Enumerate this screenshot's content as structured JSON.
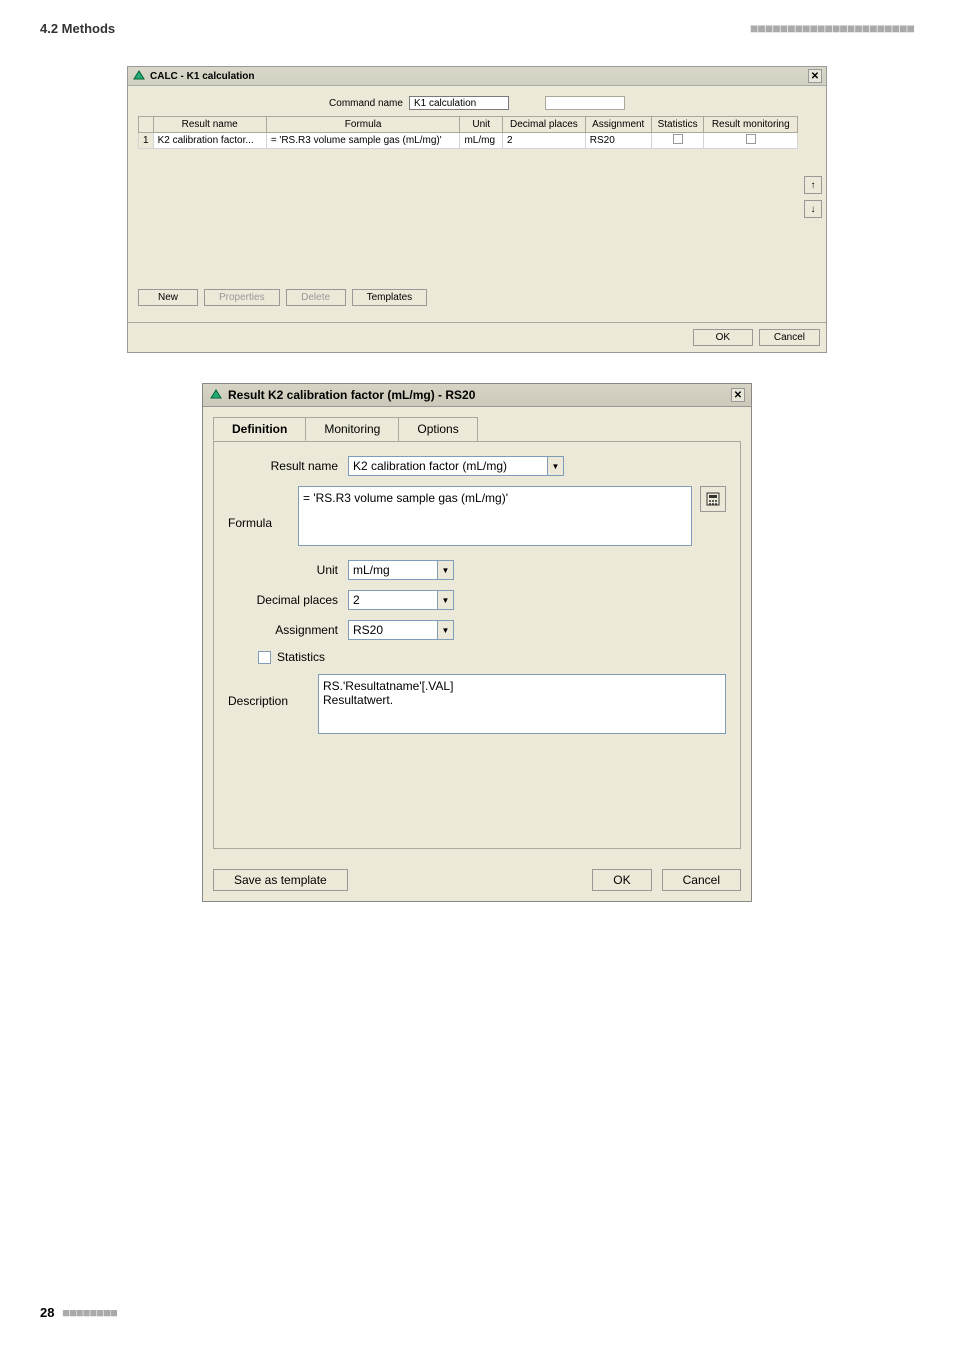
{
  "header": {
    "section": "4.2 Methods",
    "ticks": "■■■■■■■■■■■■■■■■■■■■■■"
  },
  "dialog1": {
    "title": "CALC - K1 calculation",
    "commandName_label": "Command name",
    "commandName_value": "K1 calculation",
    "columns": [
      "Result name",
      "Formula",
      "Unit",
      "Decimal places",
      "Assignment",
      "Statistics",
      "Result monitoring"
    ],
    "row": {
      "idx": "1",
      "resultName": "K2 calibration factor...",
      "formula": "= 'RS.R3 volume sample gas (mL/mg)'",
      "unit": "mL/mg",
      "decimals": "2",
      "assignment": "RS20"
    },
    "buttons": {
      "new": "New",
      "properties": "Properties",
      "delete": "Delete",
      "templates": "Templates",
      "ok": "OK",
      "cancel": "Cancel"
    }
  },
  "dialog2": {
    "title": "Result K2 calibration factor (mL/mg) - RS20",
    "tabs": [
      "Definition",
      "Monitoring",
      "Options"
    ],
    "resultName_label": "Result name",
    "resultName_value": "K2 calibration factor (mL/mg)",
    "formula_label": "Formula",
    "formula_value": "= 'RS.R3 volume sample gas (mL/mg)'",
    "unit_label": "Unit",
    "unit_value": "mL/mg",
    "decimals_label": "Decimal places",
    "decimals_value": "2",
    "assignment_label": "Assignment",
    "assignment_value": "RS20",
    "statistics_label": "Statistics",
    "description_label": "Description",
    "description_value": "RS.'Resultatname'[.VAL]\nResultatwert.",
    "buttons": {
      "saveTemplate": "Save as template",
      "ok": "OK",
      "cancel": "Cancel"
    }
  },
  "footer": {
    "pageNum": "28",
    "ticks": "■■■■■■■■"
  }
}
